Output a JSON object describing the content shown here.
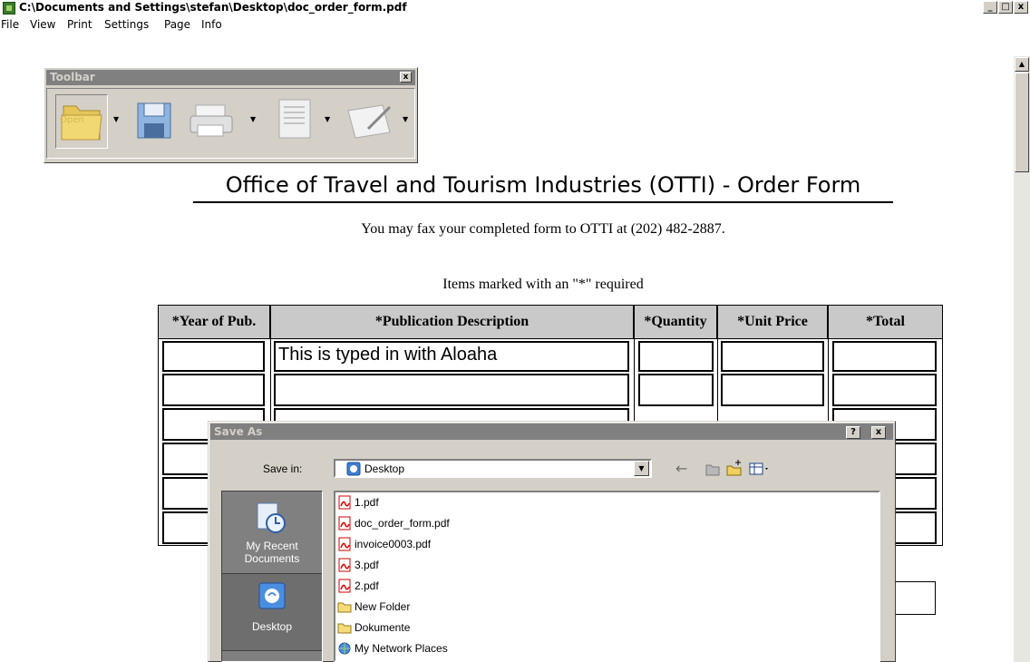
{
  "window": {
    "title": "C:\\Documents and Settings\\stefan\\Desktop\\doc_order_form.pdf",
    "minimize": "_",
    "maximize": "□",
    "close": "x"
  },
  "menu": [
    "File",
    "View",
    "Print",
    "Settings",
    "Page",
    "Info"
  ],
  "toolbar": {
    "title": "Toolbar",
    "close": "x",
    "open_label": "Open",
    "buttons": [
      "folder-open-icon",
      "save-disk-icon",
      "printer-icon",
      "page-view-icon",
      "sign-pen-icon"
    ]
  },
  "document": {
    "title": "Office of Travel and Tourism Industries (OTTI) - Order Form",
    "fax": "You may fax your completed form to OTTI at (202) 482-2887.",
    "required": "Items marked with an \"*\" required",
    "table_headers": [
      "*Year of Pub.",
      "*Publication Description",
      "*Quantity",
      "*Unit Price",
      "*Total"
    ],
    "first_row_description": "This is typed in with Aloaha"
  },
  "dialog": {
    "title": "Save As",
    "help": "?",
    "close": "x",
    "save_in_label": "Save in:",
    "save_in_value": "Desktop",
    "places": [
      "My Recent Documents",
      "Desktop"
    ],
    "files": [
      {
        "name": "1.pdf",
        "icon": "pdf-icon"
      },
      {
        "name": "doc_order_form.pdf",
        "icon": "pdf-icon"
      },
      {
        "name": "invoice0003.pdf",
        "icon": "pdf-icon"
      },
      {
        "name": "3.pdf",
        "icon": "pdf-icon"
      },
      {
        "name": "2.pdf",
        "icon": "pdf-icon"
      },
      {
        "name": "New Folder",
        "icon": "folder-icon"
      },
      {
        "name": "Dokumente",
        "icon": "folder-icon"
      },
      {
        "name": "My Network Places",
        "icon": "network-places-icon"
      }
    ]
  }
}
